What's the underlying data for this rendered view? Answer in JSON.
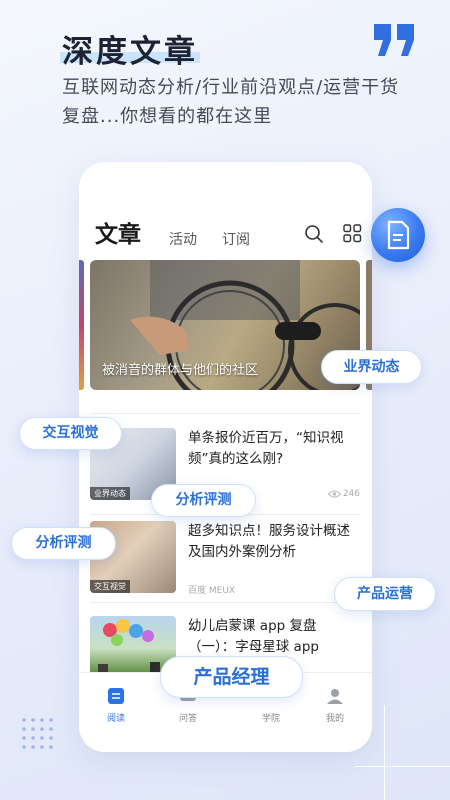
{
  "hero": {
    "title": "深度文章",
    "subtitle": "互联网动态分析/行业前沿观点/运营干货复盘...你想看的都在这里"
  },
  "app": {
    "header": {
      "title": "文章",
      "tabs": [
        "活动",
        "订阅"
      ]
    },
    "banner": {
      "caption": "被消音的群体与他们的社区"
    },
    "articles": [
      {
        "title": "单条报价近百万，“知识视频”真的这么刚?",
        "tag": "业界动态",
        "source": "",
        "views": "246"
      },
      {
        "title": "超多知识点！服务设计概述及国内外案例分析",
        "tag": "交互视觉",
        "source": "百度 MEUX",
        "views": ""
      },
      {
        "title": "幼儿启蒙课 app 复盘（一）：字母星球 app",
        "tag": "",
        "source": "",
        "views": ""
      }
    ],
    "tabbar": [
      {
        "label": "阅读",
        "icon": "read-icon",
        "active": true
      },
      {
        "label": "问答",
        "icon": "qa-icon",
        "active": false
      },
      {
        "label": "学院",
        "icon": "academy-icon",
        "active": false
      },
      {
        "label": "我的",
        "icon": "profile-icon",
        "active": false
      }
    ]
  },
  "tags": {
    "industry": "业界动态",
    "interaction": "交互视觉",
    "analysis_1": "分析评测",
    "analysis_2": "分析评测",
    "operations": "产品运营",
    "product_manager": "产品经理"
  },
  "colors": {
    "accent": "#2a6fd6",
    "title": "#1e2334",
    "badge": "#3a7bf0"
  }
}
